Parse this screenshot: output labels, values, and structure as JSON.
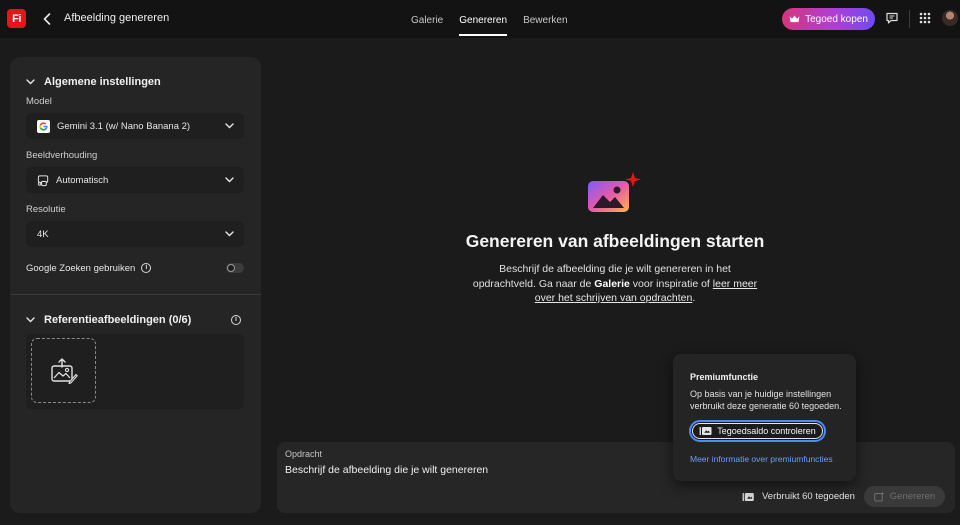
{
  "app": {
    "logo_text": "Fi",
    "title": "Afbeelding genereren",
    "accent": "#e4161b"
  },
  "nav": {
    "tabs": [
      {
        "label": "Galerie",
        "active": false
      },
      {
        "label": "Genereren",
        "active": true
      },
      {
        "label": "Bewerken",
        "active": false
      }
    ]
  },
  "header": {
    "buy_credits_label": "Tegoed kopen",
    "icons": [
      "back-arrow-icon",
      "crown-icon",
      "feedback-icon",
      "apps-grid-icon",
      "avatar"
    ]
  },
  "settings": {
    "general_title": "Algemene instellingen",
    "model_label": "Model",
    "model_value": "Gemini 3.1 (w/ Nano Banana 2)",
    "aspect_label": "Beeldverhouding",
    "aspect_value": "Automatisch",
    "resolution_label": "Resolutie",
    "resolution_value": "4K",
    "google_search_label": "Google Zoeken gebruiken",
    "google_search_on": false,
    "reference_title": "Referentieafbeeldingen (0/6)"
  },
  "empty_state": {
    "title": "Genereren van afbeeldingen starten",
    "desc_part1": "Beschrijf de afbeelding die je wilt genereren in het opdrachtveld. Ga naar de ",
    "desc_bold": "Galerie",
    "desc_part2": " voor inspiratie of ",
    "desc_link": "leer meer over het schrijven van opdrachten",
    "desc_end": "."
  },
  "prompt": {
    "label": "Opdracht",
    "placeholder": "Beschrijf de afbeelding die je wilt genereren",
    "credit_cost": "Verbruikt 60 tegoeden",
    "generate_label": "Genereren"
  },
  "popover": {
    "title": "Premiumfunctie",
    "description": "Op basis van je huidige instellingen verbruikt deze generatie 60 tegoeden.",
    "check_button": "Tegoedsaldo controleren",
    "link": "Meer informatie over premiumfuncties"
  }
}
